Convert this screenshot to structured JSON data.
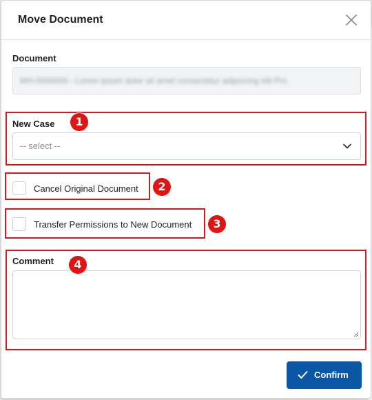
{
  "modal": {
    "title": "Move Document",
    "close_icon": "close-icon"
  },
  "document": {
    "label": "Document",
    "value": "MH-0000000 - Lorem ipsum dolor sit amet consectetur adipiscing elit Pro"
  },
  "new_case": {
    "label": "New Case",
    "selected": "-- select --",
    "icon": "chevron-down-icon"
  },
  "options": {
    "cancel_original": {
      "label": "Cancel Original Document",
      "checked": false
    },
    "transfer_permissions": {
      "label": "Transfer Permissions to New Document",
      "checked": false
    }
  },
  "comment": {
    "label": "Comment",
    "value": ""
  },
  "actions": {
    "confirm_label": "Confirm",
    "confirm_icon": "check-icon"
  },
  "annotations": {
    "badge_1": "1",
    "badge_2": "2",
    "badge_3": "3",
    "badge_4": "4",
    "color": "#d11a1a"
  },
  "colors": {
    "primary": "#0b56a5",
    "highlight": "#d11a1a",
    "badge": "#e11414"
  }
}
